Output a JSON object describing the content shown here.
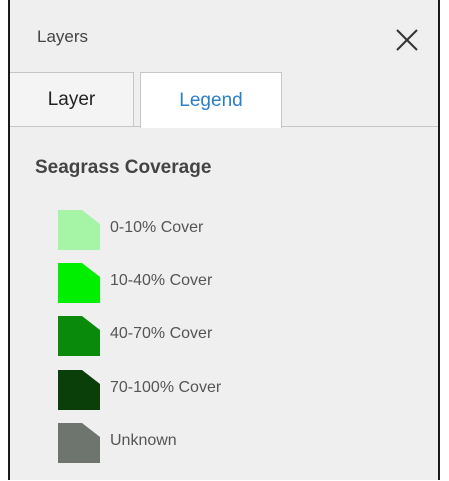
{
  "panel": {
    "title": "Layers",
    "close_icon": "close-icon"
  },
  "tabs": [
    {
      "label": "Layer",
      "active": false
    },
    {
      "label": "Legend",
      "active": true
    }
  ],
  "legend": {
    "heading": "Seagrass Coverage",
    "items": [
      {
        "label": "0-10% Cover",
        "color": "#a6f5a6"
      },
      {
        "label": "10-40% Cover",
        "color": "#00ee00"
      },
      {
        "label": "40-70% Cover",
        "color": "#0a8a0a"
      },
      {
        "label": "70-100% Cover",
        "color": "#0a3f0a"
      },
      {
        "label": "Unknown",
        "color": "#6e746e"
      }
    ]
  },
  "colors": {
    "panel_background": "#efefef",
    "active_tab_text": "#2a7fc8"
  }
}
